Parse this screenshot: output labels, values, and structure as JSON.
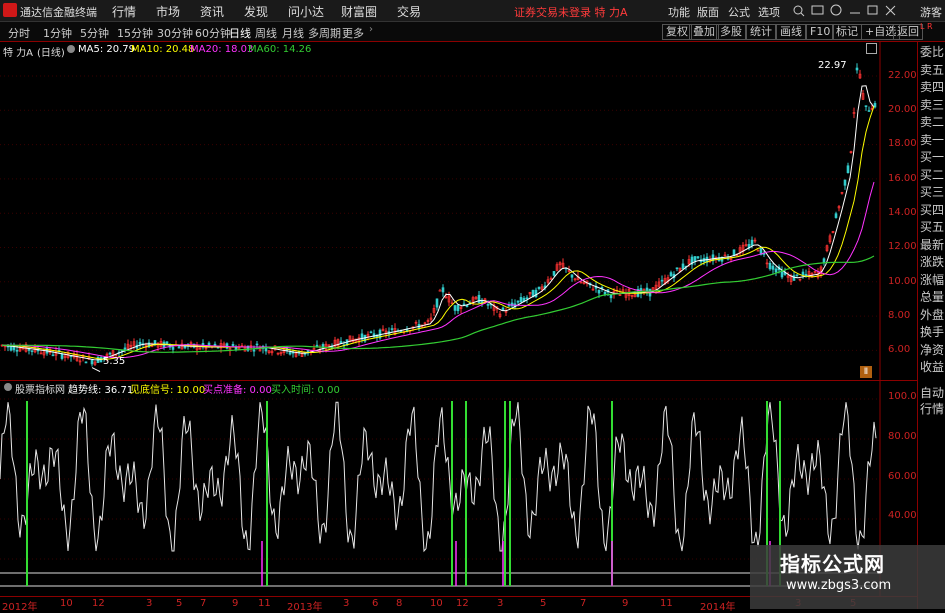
{
  "titlebar": {
    "app_title": "通达信金融终端",
    "menus": [
      "行情",
      "市场",
      "资讯",
      "发现",
      "问小达",
      "财富圈",
      "交易"
    ],
    "status": "证券交易未登录  特 力A",
    "right_menus": [
      "功能",
      "版面",
      "公式",
      "选项"
    ],
    "guest": "游客"
  },
  "toolbar": {
    "periods": [
      "分时",
      "1分钟",
      "5分钟",
      "15分钟",
      "30分钟",
      "60分钟",
      "日线",
      "周线",
      "月线",
      "多周期",
      "更多"
    ],
    "active_period": "日线",
    "buttons": [
      "复权",
      "叠加",
      "多股",
      "统计",
      "画线",
      "F10",
      "标记",
      "+自选",
      "返回"
    ]
  },
  "main_chart": {
    "stock": "特 力A",
    "period_tag": "(日线)",
    "ma5": "MA5: 20.79",
    "ma10": "MA10: 20.48",
    "ma20": "MA20: 18.03",
    "ma60": "MA60: 14.26",
    "high_label": "22.97",
    "low_label": "5.35",
    "y_ticks": [
      "22.00",
      "20.00",
      "18.00",
      "16.00",
      "14.00",
      "12.00",
      "10.00",
      "8.00",
      "6.00"
    ],
    "corner_tag": "Ⅱ"
  },
  "sub_chart": {
    "title": "股票指标网",
    "trend": "趋势线: 36.71",
    "signal": "见底信号: 10.00",
    "buy_ready": "买点准备: 0.00",
    "buy_time": "买入时间: 0.00",
    "y_ticks": [
      "100.00",
      "80.00",
      "60.00",
      "40.00"
    ]
  },
  "date_axis": [
    "2012年",
    "10",
    "12",
    "3",
    "5",
    "7",
    "9",
    "11",
    "2013年",
    "3",
    "6",
    "8",
    "10",
    "12",
    "3",
    "5",
    "7",
    "9",
    "11",
    "2014年",
    "3",
    "5"
  ],
  "sidebar": {
    "top": "L R",
    "items": [
      "委比",
      "卖五",
      "卖四",
      "卖三",
      "卖二",
      "卖一",
      "买一",
      "买二",
      "买三",
      "买四",
      "买五",
      "最新",
      "涨跌",
      "涨幅",
      "总量",
      "外盘",
      "换手",
      "净资",
      "收益"
    ],
    "bottom": [
      "自动",
      "行情"
    ]
  },
  "watermark": {
    "title": "指标公式网",
    "url": "www.zbgs3.com"
  },
  "colors": {
    "ma5": "#ffffff",
    "ma10": "#ffff00",
    "ma20": "#ff33ff",
    "ma60": "#33cc33",
    "up": "#ff3333",
    "down": "#33cccc",
    "axis": "#cc2222"
  }
}
